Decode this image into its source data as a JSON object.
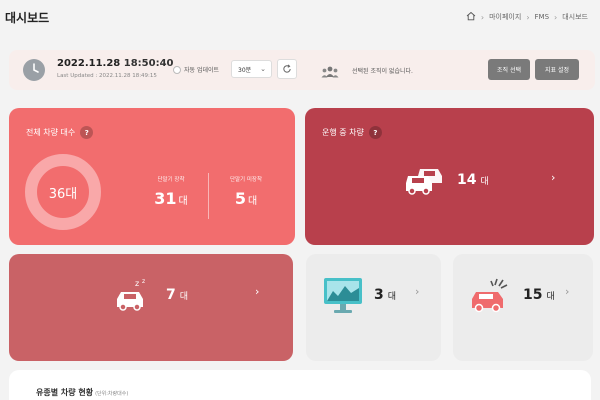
{
  "page": {
    "title": "대시보드"
  },
  "breadcrumb": {
    "items": [
      "마이페이지",
      "FMS",
      "대시보드"
    ]
  },
  "status": {
    "date": "2022.11.28",
    "time": "18:50:40",
    "last_updated": "Last Updated : 2022.11.28 18:49:15",
    "auto_update_label": "자동 업데이트",
    "interval_value": "30분",
    "org_text": "선택된 조직이 없습니다.",
    "org_select_label": "조직 선택",
    "goal_setting_label": "지표 설정"
  },
  "cards": {
    "total": {
      "title": "전체 차량 대수",
      "total_value": "36대",
      "attached_label": "단말기 장착",
      "attached_value": "31",
      "not_attached_label": "단말기 미장착",
      "not_attached_value": "5",
      "unit": "대"
    },
    "running": {
      "title": "운행 중 차량",
      "value": "14",
      "unit": "대"
    },
    "idle": {
      "value": "7",
      "unit": "대"
    },
    "maintenance": {
      "value": "3",
      "unit": "대"
    },
    "accident": {
      "value": "15",
      "unit": "대"
    },
    "by_fuel": {
      "title": "유종별 차량 현황",
      "subtitle": "(단위:차량대수)"
    }
  },
  "colors": {
    "total_card": "#f26d6e",
    "running_card": "#b8404c",
    "idle_card": "#c96266",
    "light_card": "#ececec"
  },
  "icons": [
    "home-icon",
    "clock-icon",
    "refresh-icon",
    "people-icon",
    "cars-icon",
    "sleeping-car-icon",
    "monitor-icon",
    "broken-car-icon",
    "chevron-right-icon",
    "help-icon"
  ]
}
